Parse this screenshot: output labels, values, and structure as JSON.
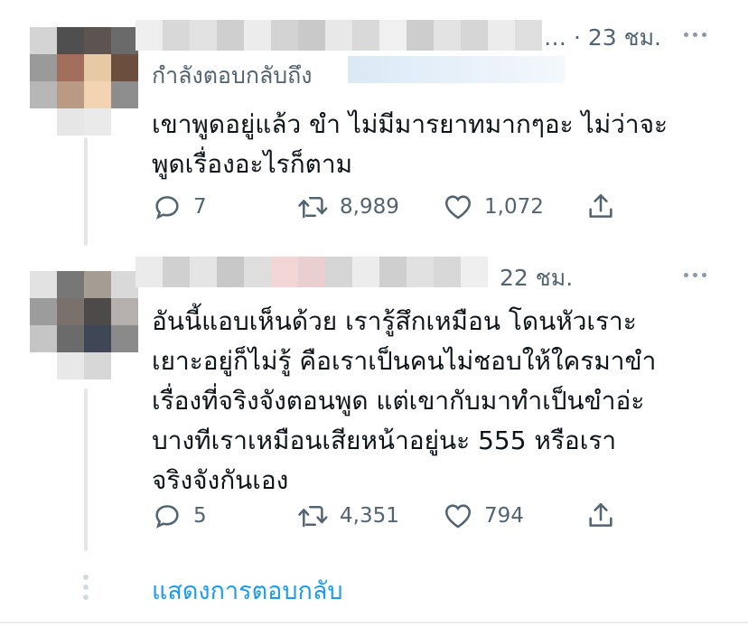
{
  "tweets": [
    {
      "time": "… · 23 ชม.",
      "reply_to_label": "กำลังตอบกลับถึง",
      "text": "เขาพูดอยู่แล้ว ขำ ไม่มีมารยาทมากๆอะ ไม่ว่าจะ\nพูดเรื่องอะไรก็ตาม",
      "replies": "7",
      "retweets": "8,989",
      "likes": "1,072"
    },
    {
      "time": "22 ชม.",
      "text": "อันนี้แอบเห็นด้วย เรารู้สึกเหมือน โดนหัวเราะ\nเยาะอยู่ก็ไม่รู้ คือเราเป็นคนไม่ชอบให้ใครมาขำ\nเรื่องที่จริงจังตอนพูด แต่เขากับมาทำเป็นขำอ่ะ\nบางทีเราเหมือนเสียหน้าอยู่นะ 555 หรือเรา\nจริงจังกันเอง",
      "replies": "5",
      "retweets": "4,351",
      "likes": "794"
    }
  ],
  "show_replies": "แสดงการตอบกลับ",
  "icons": [
    "reply-icon",
    "retweet-icon",
    "like-icon",
    "share-icon",
    "more-icon"
  ],
  "colors": {
    "link": "#1d9bf0",
    "muted": "#536471",
    "text": "#0f1419"
  }
}
